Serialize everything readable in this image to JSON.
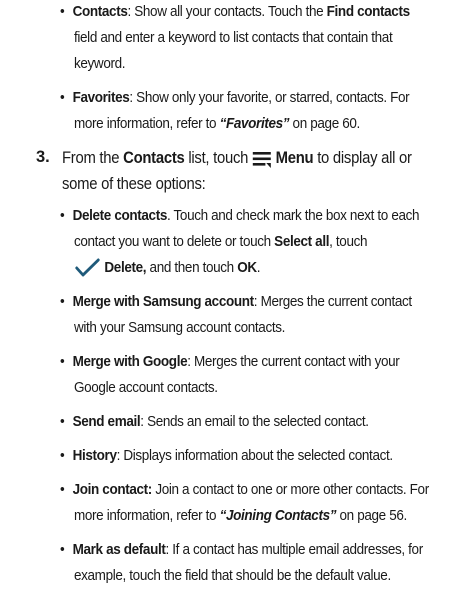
{
  "items": {
    "contacts": {
      "term": "Contacts",
      "l1a": ": Show all your contacts. Touch the ",
      "field": "Find contacts",
      "l2": "field and enter a keyword to list contacts that contain that",
      "l3": "keyword."
    },
    "favorites": {
      "term": "Favorites",
      "l1": ": Show only your favorite, or starred, contacts. For",
      "l2a": "more information, refer to ",
      "ref": "“Favorites”",
      "l2b": " on page 60."
    }
  },
  "step3": {
    "number": "3.",
    "a": "From the ",
    "list": "Contacts",
    "b": " list, touch ",
    "menu": "Menu",
    "c": " to display all or",
    "l2": "some of these options:"
  },
  "options": {
    "delete": {
      "term": "Delete contacts",
      "l1": ". Touch and check mark the box next to each",
      "l2a": "contact you want to delete or touch ",
      "selectall": "Select all",
      "l2b": ", touch",
      "del": "Delete,",
      "l3b": " and then touch ",
      "ok": "OK",
      "l3c": "."
    },
    "merge_samsung": {
      "term": "Merge with Samsung account",
      "l1": ": Merges the current contact",
      "l2": "with your Samsung account contacts."
    },
    "merge_google": {
      "term": "Merge with Google",
      "l1": ": Merges the current contact with your",
      "l2": "Google account contacts."
    },
    "send_email": {
      "term": "Send email",
      "l1": ": Sends an email to the selected contact."
    },
    "history": {
      "term": "History",
      "l1": ": Displays information about the selected contact."
    },
    "join": {
      "term": "Join contact:",
      "l1": " Join a contact to one or more other contacts. For",
      "l2a": "more information, refer to ",
      "ref": "“Joining Contacts”",
      "l2b": " on page 56."
    },
    "default": {
      "term": "Mark as default",
      "l1": ": If a contact has multiple email addresses, for",
      "l2": "example, touch the field that should be the default value."
    }
  },
  "icons": {
    "menu": "menu-icon",
    "check": "checkmark-icon"
  },
  "colors": {
    "check": "#1f5a7a",
    "text": "#1a1a1a"
  }
}
